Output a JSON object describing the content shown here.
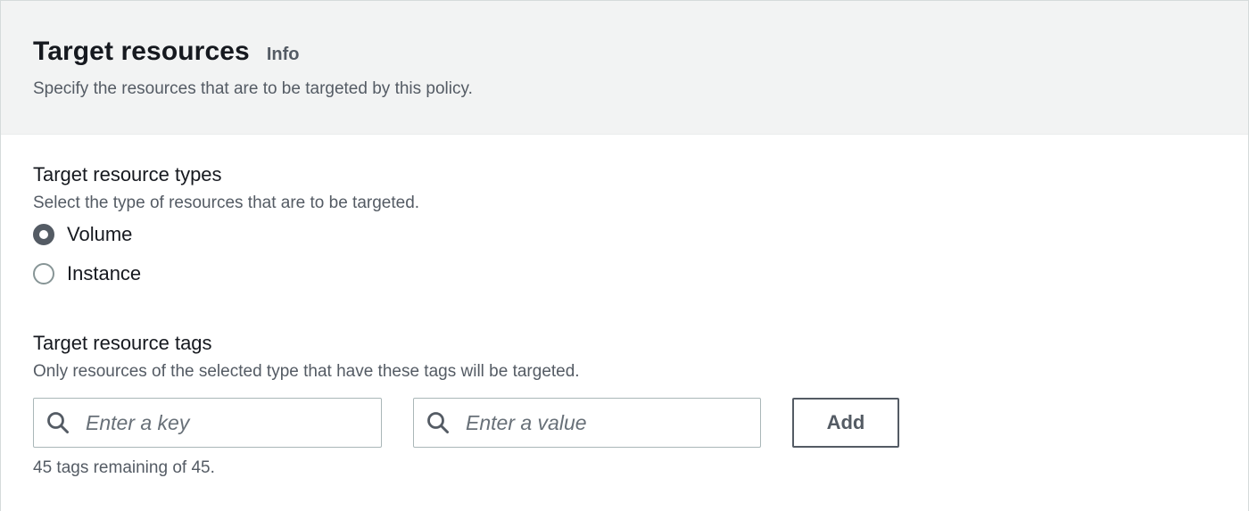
{
  "header": {
    "title": "Target resources",
    "info_label": "Info",
    "description": "Specify the resources that are to be targeted by this policy."
  },
  "resource_types": {
    "label": "Target resource types",
    "description": "Select the type of resources that are to be targeted.",
    "options": [
      {
        "label": "Volume",
        "checked": true
      },
      {
        "label": "Instance",
        "checked": false
      }
    ]
  },
  "resource_tags": {
    "label": "Target resource tags",
    "description": "Only resources of the selected type that have these tags will be targeted.",
    "key_input": {
      "placeholder": "Enter a key",
      "value": ""
    },
    "value_input": {
      "placeholder": "Enter a value",
      "value": ""
    },
    "add_label": "Add",
    "remaining_text": "45 tags remaining of 45."
  },
  "colors": {
    "header_bg": "#f2f3f3",
    "border": "#aab7b8",
    "text_primary": "#16191f",
    "text_secondary": "#545b64",
    "radio_checked": "#545b64"
  },
  "icons": {
    "search": "search-icon"
  }
}
